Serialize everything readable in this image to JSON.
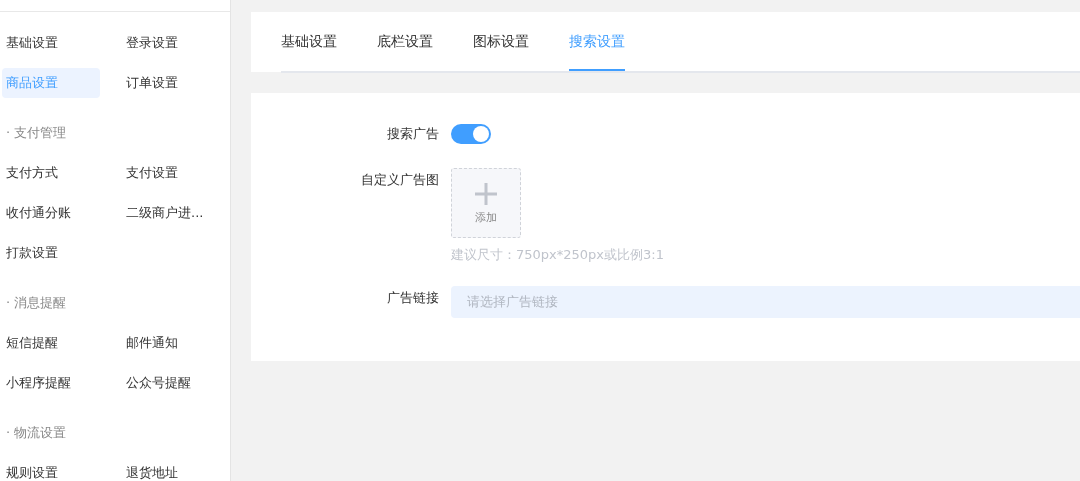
{
  "sidebar": {
    "sections": [
      {
        "items": [
          {
            "label": "基础设置",
            "selected": false
          },
          {
            "label": "登录设置",
            "selected": false
          },
          {
            "label": "商品设置",
            "selected": true
          },
          {
            "label": "订单设置",
            "selected": false
          }
        ]
      },
      {
        "title": "· 支付管理",
        "items": [
          {
            "label": "支付方式",
            "selected": false
          },
          {
            "label": "支付设置",
            "selected": false
          },
          {
            "label": "收付通分账",
            "selected": false
          },
          {
            "label": "二级商户进...",
            "selected": false
          },
          {
            "label": "打款设置",
            "selected": false
          }
        ]
      },
      {
        "title": "· 消息提醒",
        "items": [
          {
            "label": "短信提醒",
            "selected": false
          },
          {
            "label": "邮件通知",
            "selected": false
          },
          {
            "label": "小程序提醒",
            "selected": false
          },
          {
            "label": "公众号提醒",
            "selected": false
          }
        ]
      },
      {
        "title": "· 物流设置",
        "items": [
          {
            "label": "规则设置",
            "selected": false
          },
          {
            "label": "退货地址",
            "selected": false
          }
        ]
      }
    ]
  },
  "tabs": [
    {
      "label": "基础设置",
      "selected": false
    },
    {
      "label": "底栏设置",
      "selected": false
    },
    {
      "label": "图标设置",
      "selected": false
    },
    {
      "label": "搜索设置",
      "selected": true
    }
  ],
  "form": {
    "rows": [
      {
        "kind": "switch",
        "label": "搜索广告",
        "on": true
      },
      {
        "kind": "upload",
        "label": "自定义广告图",
        "button": "添加",
        "hint": "建议尺寸：750px*250px或比例3:1"
      },
      {
        "kind": "select",
        "label": "广告链接",
        "placeholder": "请选择广告链接"
      }
    ]
  }
}
